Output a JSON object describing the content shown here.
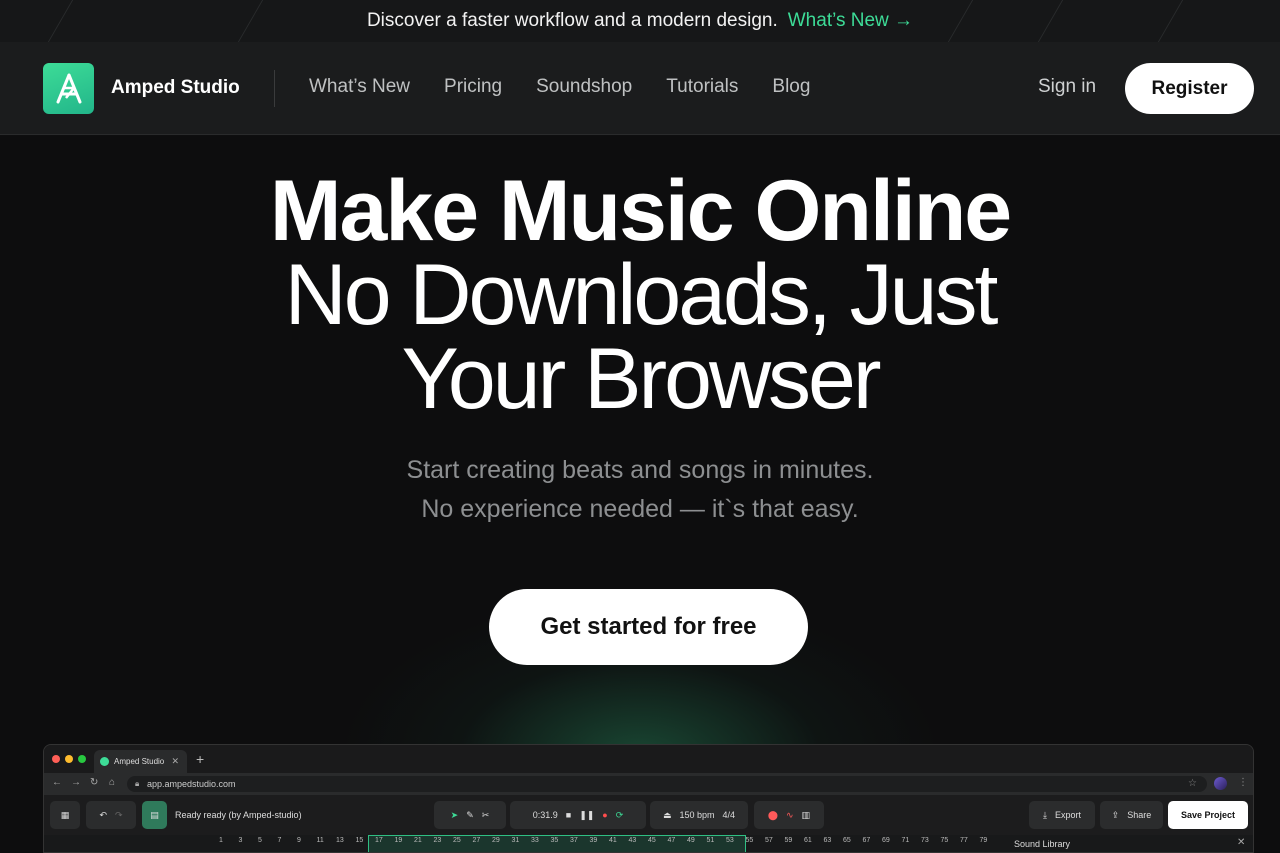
{
  "announcement": {
    "text": "Discover a faster workflow and a modern design.",
    "link": "What’s New →"
  },
  "header": {
    "brand": "Amped Studio",
    "nav": [
      "What’s New",
      "Pricing",
      "Soundshop",
      "Tutorials",
      "Blog"
    ],
    "sign_in": "Sign in",
    "register": "Register"
  },
  "hero": {
    "title": "Make Music Online",
    "subtitle_line1": "No Downloads, Just",
    "subtitle_line2": "Your Browser",
    "desc_line1": "Start creating beats and songs in minutes.",
    "desc_line2": "No experience needed — it`s that easy.",
    "cta": "Get started for free"
  },
  "app_preview": {
    "tab_title": "Amped Studio",
    "url": "app.ampedstudio.com",
    "status": "Ready ready (by Amped-studio)",
    "time": "0:31.9",
    "bpm": "150 bpm",
    "signature": "4/4",
    "export": "Export",
    "share": "Share",
    "save_project": "Save Project",
    "sound_library": "Sound Library",
    "ruler_numbers": [
      "1",
      "3",
      "5",
      "7",
      "9",
      "11",
      "13",
      "15",
      "17",
      "19",
      "21",
      "23",
      "25",
      "27",
      "29",
      "31",
      "33",
      "35",
      "37",
      "39",
      "41",
      "43",
      "45",
      "47",
      "49",
      "51",
      "53",
      "55",
      "57",
      "59",
      "61",
      "63",
      "65",
      "67",
      "69",
      "71",
      "73",
      "75",
      "77",
      "79"
    ]
  },
  "colors": {
    "accent": "#3ddc97",
    "background": "#0d0d0e",
    "header": "#1b1c1d"
  }
}
